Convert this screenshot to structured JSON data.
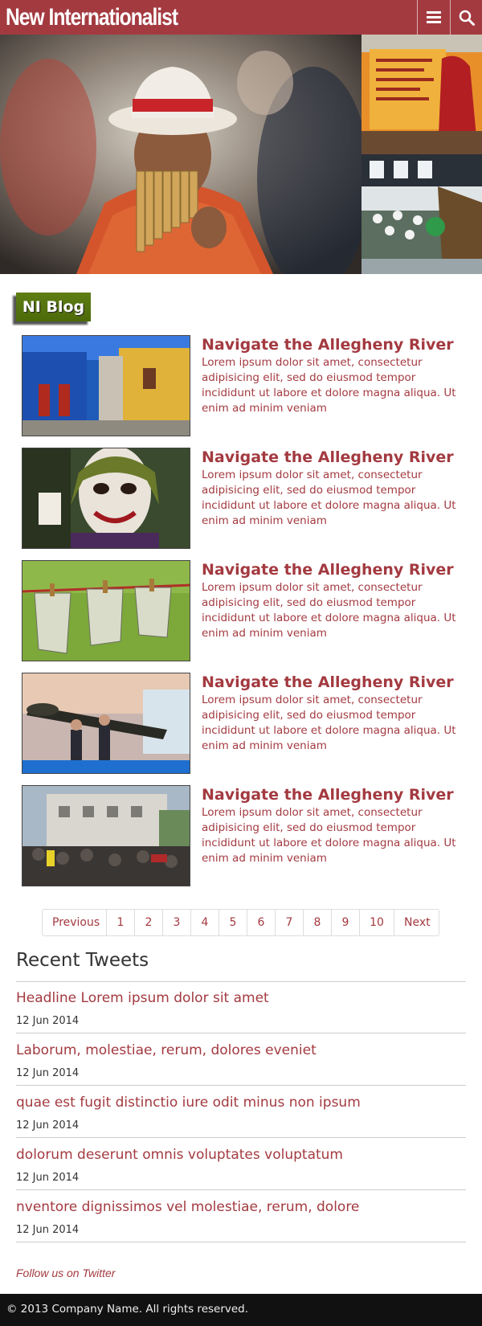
{
  "header": {
    "logo": "New Internationalist",
    "menu_icon": "menu-icon",
    "search_icon": "search-icon",
    "background": "#a33a40"
  },
  "hero": {
    "images": [
      "panpipe-player-photo",
      "protest-banner-photo",
      "crowd-march-photo"
    ]
  },
  "blog": {
    "badge": "NI Blog",
    "badge_color": "#4d6a0a",
    "posts": [
      {
        "title": "Navigate the Allegheny River",
        "text": "Lorem ipsum dolor sit amet, consectetur adipisicing elit, sed do eiusmod tempor incididunt ut labore et dolore magna aliqua. Ut enim ad minim veniam",
        "image": "colorful-street-photo"
      },
      {
        "title": "Navigate the Allegheny River",
        "text": "Lorem ipsum dolor sit amet, consectetur adipisicing elit, sed do eiusmod tempor incididunt ut labore et dolore magna aliqua. Ut enim ad minim veniam",
        "image": "joker-photo"
      },
      {
        "title": "Navigate the Allegheny River",
        "text": "Lorem ipsum dolor sit amet, consectetur adipisicing elit, sed do eiusmod tempor incididunt ut labore et dolore magna aliqua. Ut enim ad minim veniam",
        "image": "money-clothesline-photo"
      },
      {
        "title": "Navigate the Allegheny River",
        "text": "Lorem ipsum dolor sit amet, consectetur adipisicing elit, sed do eiusmod tempor incididunt ut labore et dolore magna aliqua. Ut enim ad minim veniam",
        "image": "missile-expo-photo"
      },
      {
        "title": "Navigate the Allegheny River",
        "text": "Lorem ipsum dolor sit amet, consectetur adipisicing elit, sed do eiusmod tempor incididunt ut labore et dolore magna aliqua. Ut enim ad minim veniam",
        "image": "street-protest-photo"
      }
    ]
  },
  "pagination": {
    "previous": "Previous",
    "pages": [
      "1",
      "2",
      "3",
      "4",
      "5",
      "6",
      "7",
      "8",
      "9",
      "10"
    ],
    "next": "Next"
  },
  "tweets": {
    "title": "Recent Tweets",
    "items": [
      {
        "text": "Headline Lorem ipsum dolor sit amet",
        "date": "12 Jun 2014"
      },
      {
        "text": "Laborum, molestiae, rerum, dolores eveniet",
        "date": "12 Jun 2014"
      },
      {
        "text": "quae est fugit distinctio iure odit minus non ipsum",
        "date": "12 Jun 2014"
      },
      {
        "text": "dolorum deserunt omnis voluptates voluptatum",
        "date": "12 Jun 2014"
      },
      {
        "text": "nventore dignissimos vel molestiae, rerum, dolore",
        "date": "12 Jun 2014"
      }
    ],
    "follow": "Follow us on Twitter"
  },
  "footer": {
    "copyright": "© 2013 Company Name. All rights reserved."
  }
}
